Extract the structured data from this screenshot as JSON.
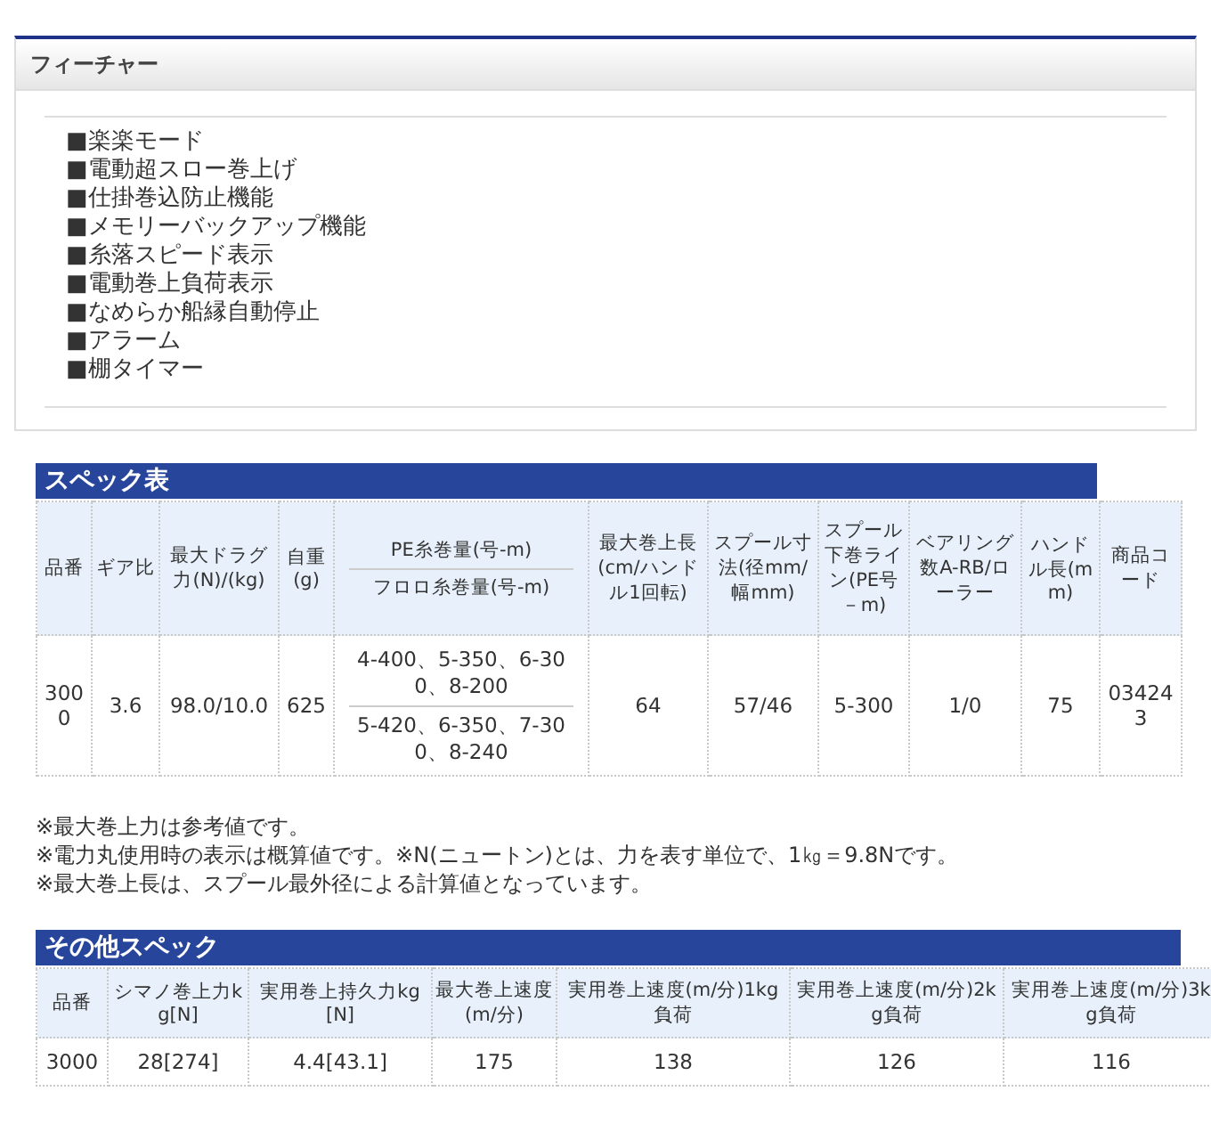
{
  "feature": {
    "title": "フィーチャー",
    "items": [
      "■楽楽モード",
      "■電動超スロー巻上げ",
      "■仕掛巻込防止機能",
      "■メモリーバックアップ機能",
      "■糸落スピード表示",
      "■電動巻上負荷表示",
      "■なめらか船縁自動停止",
      "■アラーム",
      "■棚タイマー"
    ]
  },
  "spec_table": {
    "title": "スペック表",
    "columns": [
      {
        "label": "品番"
      },
      {
        "label": "ギア比"
      },
      {
        "label": "最大ドラグ力(N)/(kg)"
      },
      {
        "label": "自重(g)"
      },
      {
        "label": "PE糸巻量(号-m)",
        "sublabel": "フロロ糸巻量(号-m)"
      },
      {
        "label": "最大巻上長(cm/ハンドル1回転)"
      },
      {
        "label": "スプール寸法(径mm/幅mm)"
      },
      {
        "label": "スプール下巻ライン(PE号－m)"
      },
      {
        "label": "ベアリング数A-RB/ローラー"
      },
      {
        "label": "ハンドル長(mm)"
      },
      {
        "label": "商品コード"
      }
    ],
    "rows": [
      {
        "cells": [
          "3000",
          "3.6",
          "98.0/10.0",
          "625",
          [
            "4-400、5-350、6-300、8-200",
            "5-420、6-350、7-300、8-240"
          ],
          "64",
          "57/46",
          "5-300",
          "1/0",
          "75",
          "034243"
        ]
      }
    ]
  },
  "notes": [
    "※最大巻上力は参考値です。",
    "※電力丸使用時の表示は概算値です。※N(ニュートン)とは、力を表す単位で、1㎏＝9.8Nです。",
    "※最大巻上長は、スプール最外径による計算値となっています。"
  ],
  "other_table": {
    "title": "その他スペック",
    "columns": [
      {
        "label": "品番"
      },
      {
        "label": "シマノ巻上力kg[N]"
      },
      {
        "label": "実用巻上持久力kg[N]"
      },
      {
        "label": "最大巻上速度(m/分)"
      },
      {
        "label": "実用巻上速度(m/分)1kg負荷"
      },
      {
        "label": "実用巻上速度(m/分)2kg負荷"
      },
      {
        "label": "実用巻上速度(m/分)3kg負荷"
      }
    ],
    "rows": [
      {
        "cells": [
          "3000",
          "28[274]",
          "4.4[43.1]",
          "175",
          "138",
          "126",
          "116"
        ]
      }
    ]
  }
}
